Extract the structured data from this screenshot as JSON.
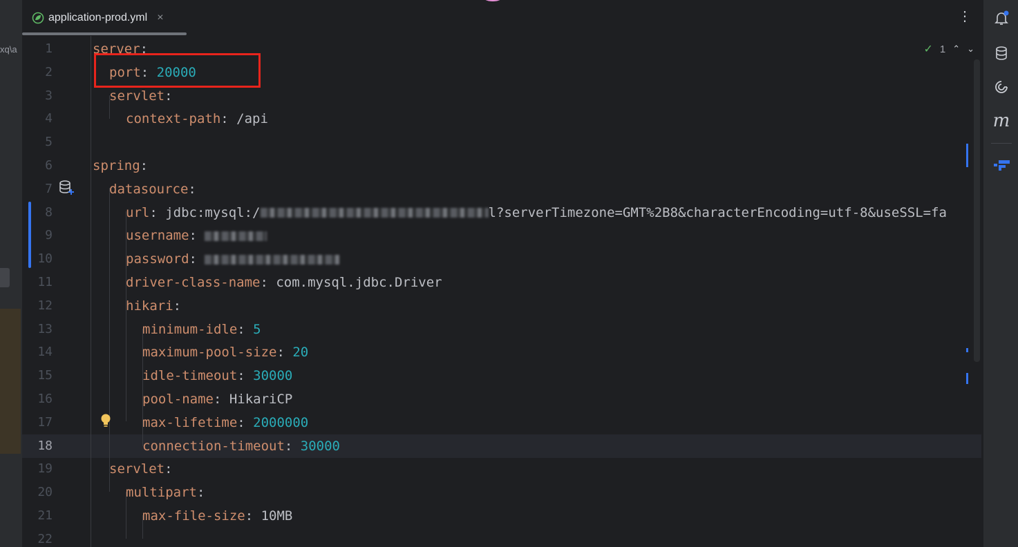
{
  "left_panel": {
    "crumb_text": "xq\\a"
  },
  "tab": {
    "label": "application-prod.yml",
    "icon": "spring-leaf-icon",
    "close_glyph": "×"
  },
  "toolbar": {
    "more_glyph": "⋮"
  },
  "inspections": {
    "check_glyph": "✓",
    "count": "1",
    "up_glyph": "⌃",
    "down_glyph": "⌄"
  },
  "editor": {
    "current_line": 18,
    "lines": [
      {
        "n": "1",
        "key": "server",
        "sep": ":",
        "value": ""
      },
      {
        "n": "2",
        "key": "port",
        "sep": ": ",
        "value": "20000"
      },
      {
        "n": "3",
        "key": "servlet",
        "sep": ":",
        "value": ""
      },
      {
        "n": "4",
        "key": "context-path",
        "sep": ": ",
        "value": "/api"
      },
      {
        "n": "5",
        "key": "",
        "sep": "",
        "value": ""
      },
      {
        "n": "6",
        "key": "spring",
        "sep": ":",
        "value": ""
      },
      {
        "n": "7",
        "key": "datasource",
        "sep": ":",
        "value": ""
      },
      {
        "n": "8",
        "key": "url",
        "sep": ": ",
        "value_prefix": "jdbc:mysql:/",
        "value_suffix": "l?serverTimezone=GMT%2B8&characterEncoding=utf-8&useSSL=fa"
      },
      {
        "n": "9",
        "key": "username",
        "sep": ": ",
        "value": ""
      },
      {
        "n": "10",
        "key": "password",
        "sep": ": ",
        "value": ""
      },
      {
        "n": "11",
        "key": "driver-class-name",
        "sep": ": ",
        "value": "com.mysql.jdbc.Driver"
      },
      {
        "n": "12",
        "key": "hikari",
        "sep": ":",
        "value": ""
      },
      {
        "n": "13",
        "key": "minimum-idle",
        "sep": ": ",
        "value": "5"
      },
      {
        "n": "14",
        "key": "maximum-pool-size",
        "sep": ": ",
        "value": "20"
      },
      {
        "n": "15",
        "key": "idle-timeout",
        "sep": ": ",
        "value": "30000"
      },
      {
        "n": "16",
        "key": "pool-name",
        "sep": ": ",
        "value": "HikariCP"
      },
      {
        "n": "17",
        "key": "max-lifetime",
        "sep": ": ",
        "value": "2000000"
      },
      {
        "n": "18",
        "key": "connection-timeout",
        "sep": ": ",
        "value": "30000"
      },
      {
        "n": "19",
        "key": "servlet",
        "sep": ":",
        "value": ""
      },
      {
        "n": "20",
        "key": "multipart",
        "sep": ":",
        "value": ""
      },
      {
        "n": "21",
        "key": "max-file-size",
        "sep": ": ",
        "value": "10MB"
      },
      {
        "n": "22",
        "key": "",
        "sep": "",
        "value": ""
      }
    ]
  },
  "right_toolbar": {
    "icons": [
      "notifications-icon",
      "database-icon",
      "ai-assistant-icon",
      "maven-icon",
      "structure-plugin-icon"
    ],
    "maven_glyph": "m"
  },
  "colors": {
    "background": "#1e1f22",
    "key": "#cf8e6d",
    "number": "#2aacb8",
    "text": "#bcbec4",
    "highlight_box": "#e8241c",
    "change_marker": "#3574f0"
  }
}
